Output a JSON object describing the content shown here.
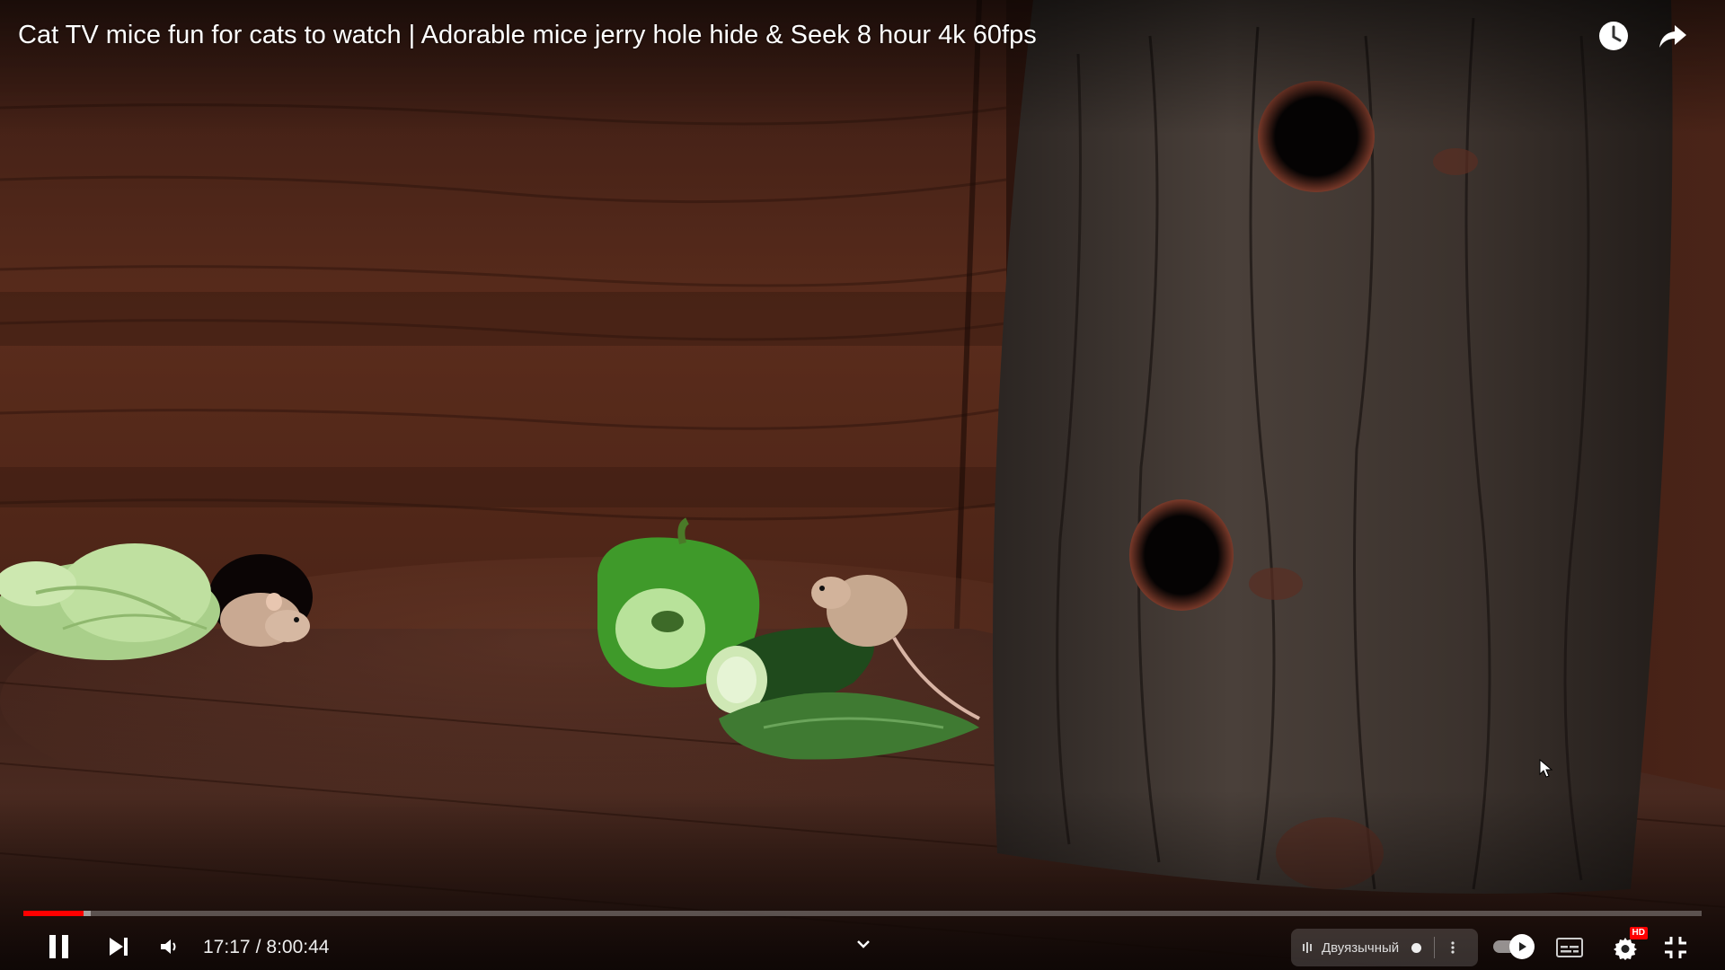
{
  "video": {
    "title": "Cat TV mice fun for cats to watch | Adorable mice jerry hole hide & Seek 8 hour 4k 60fps"
  },
  "top_actions": [
    {
      "name": "watch-later",
      "icon": "clock-icon"
    },
    {
      "name": "share",
      "icon": "share-arrow-icon"
    }
  ],
  "playback": {
    "current_time": "17:17",
    "separator": "/",
    "duration": "8:00:44",
    "progress_fraction": 0.036,
    "buffered_fraction": 0.04,
    "state": "playing"
  },
  "controls": {
    "play_pause_icon": "pause-icon",
    "next_icon": "next-icon",
    "volume_icon": "volume-icon",
    "chapter_icon": "chevron-down-icon",
    "audio_track_label": "Двуязычный",
    "audio_track_icon": "audio-track-icon",
    "more_icon": "more-vertical-icon",
    "autoplay_icon": "autoplay-toggle-icon",
    "subtitles_icon": "subtitles-icon",
    "settings_icon": "gear-icon",
    "quality_badge": "HD",
    "fullscreen_exit_icon": "exit-fullscreen-icon"
  },
  "colors": {
    "progress_played": "#ff0000",
    "controls_text": "#eeeeee",
    "background_wood": "#4a2418"
  }
}
